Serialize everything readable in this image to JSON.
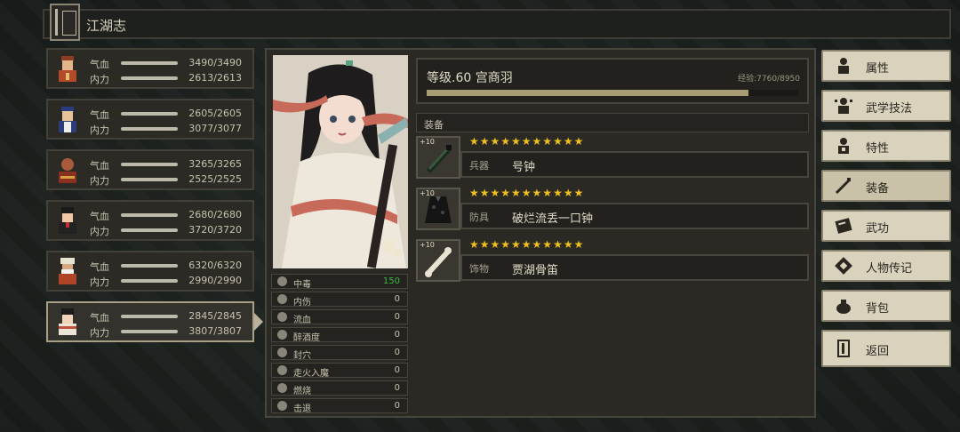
{
  "header": {
    "title": "江湖志"
  },
  "characters": [
    {
      "hp_label": "气血",
      "hp": "3490/3490",
      "mp_label": "内力",
      "mp": "2613/2613",
      "selected": false
    },
    {
      "hp_label": "气血",
      "hp": "2605/2605",
      "mp_label": "内力",
      "mp": "3077/3077",
      "selected": false
    },
    {
      "hp_label": "气血",
      "hp": "3265/3265",
      "mp_label": "内力",
      "mp": "2525/2525",
      "selected": false
    },
    {
      "hp_label": "气血",
      "hp": "2680/2680",
      "mp_label": "内力",
      "mp": "3720/3720",
      "selected": false
    },
    {
      "hp_label": "气血",
      "hp": "6320/6320",
      "mp_label": "内力",
      "mp": "2990/2990",
      "selected": false
    },
    {
      "hp_label": "气血",
      "hp": "2845/2845",
      "mp_label": "内力",
      "mp": "3807/3807",
      "selected": true
    }
  ],
  "profile": {
    "level_name": "等级.60 宫商羽",
    "exp_text": "经验:7760/8950",
    "exp_fraction": 0.867
  },
  "equipment": {
    "header": "装备",
    "slots": [
      {
        "level": "+10",
        "stars": "★★★★★★★★★★★",
        "type": "兵器",
        "name": "号钟",
        "icon": "sword-icon"
      },
      {
        "level": "+10",
        "stars": "★★★★★★★★★★★",
        "type": "防具",
        "name": "破烂流丢一口钟",
        "icon": "cloak-icon"
      },
      {
        "level": "+10",
        "stars": "★★★★★★★★★★★",
        "type": "饰物",
        "name": "贾湖骨笛",
        "icon": "bone-flute-icon"
      }
    ]
  },
  "statuses": [
    {
      "name": "中毒",
      "value": "150",
      "highlight": true,
      "icon": "poison-icon"
    },
    {
      "name": "内伤",
      "value": "0",
      "highlight": false,
      "icon": "broken-heart-icon"
    },
    {
      "name": "流血",
      "value": "0",
      "highlight": false,
      "icon": "blood-drop-icon"
    },
    {
      "name": "醉酒度",
      "value": "0",
      "highlight": false,
      "icon": "wine-icon"
    },
    {
      "name": "封穴",
      "value": "0",
      "highlight": false,
      "icon": "seal-icon"
    },
    {
      "name": "走火入魔",
      "value": "0",
      "highlight": false,
      "icon": "demon-icon"
    },
    {
      "name": "燃烧",
      "value": "0",
      "highlight": false,
      "icon": "flame-icon"
    },
    {
      "name": "击退",
      "value": "0",
      "highlight": false,
      "icon": "knockback-icon"
    }
  ],
  "menu": [
    {
      "label": "属性",
      "icon": "attribute-icon",
      "active": false
    },
    {
      "label": "武学技法",
      "icon": "martial-arts-icon",
      "active": false
    },
    {
      "label": "特性",
      "icon": "trait-icon",
      "active": false
    },
    {
      "label": "装备",
      "icon": "equipment-icon",
      "active": true
    },
    {
      "label": "武功",
      "icon": "skill-book-icon",
      "active": false
    },
    {
      "label": "人物传记",
      "icon": "biography-icon",
      "active": false
    },
    {
      "label": "背包",
      "icon": "bag-icon",
      "active": false
    },
    {
      "label": "返回",
      "icon": "door-icon",
      "active": false
    }
  ],
  "colors": {
    "star": "#f0c020",
    "poison_value": "#3fb83f",
    "exp_fill": "#a89c72"
  }
}
